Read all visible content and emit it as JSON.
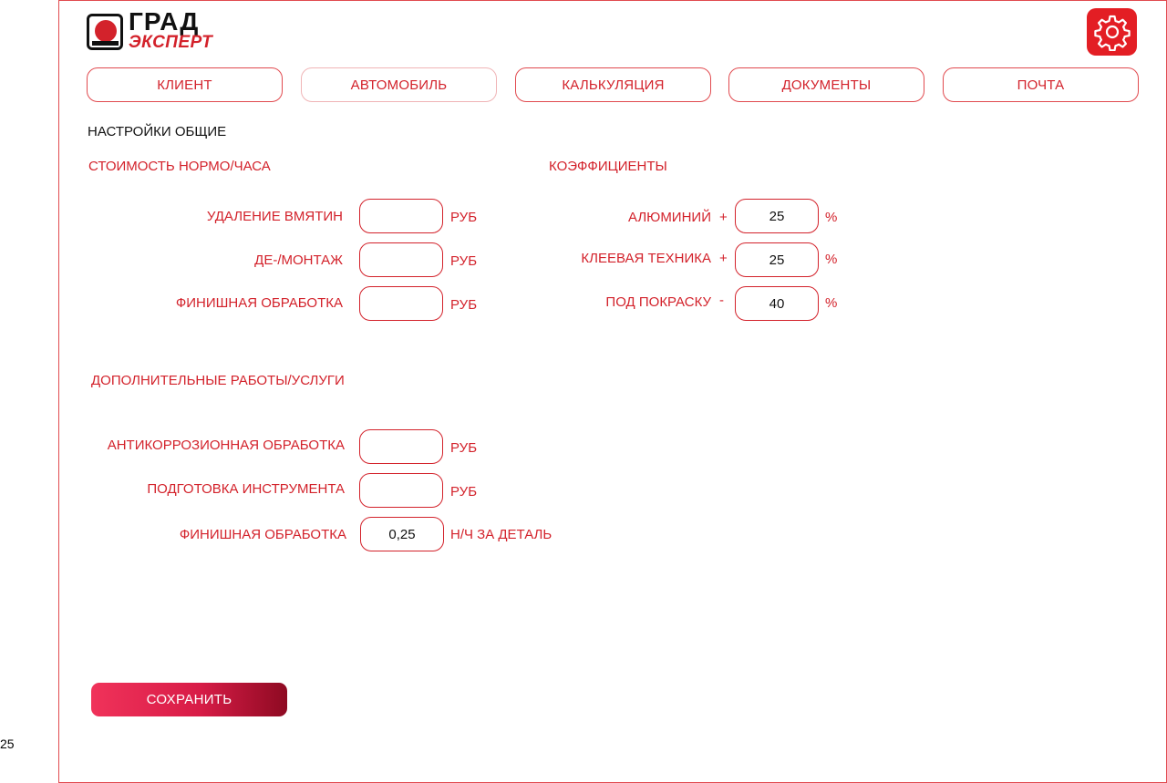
{
  "page_number": "25",
  "logo": {
    "line1": "ГРАД",
    "line2": "ЭКСПЕРТ"
  },
  "settings_icon": "gear-icon",
  "tabs": [
    {
      "label": "КЛИЕНТ",
      "active": false
    },
    {
      "label": "АВТОМОБИЛЬ",
      "active": true
    },
    {
      "label": "КАЛЬКУЛЯЦИЯ",
      "active": false
    },
    {
      "label": "ДОКУМЕНТЫ",
      "active": false
    },
    {
      "label": "ПОЧТА",
      "active": false
    }
  ],
  "page_title": "НАСТРОЙКИ ОБЩИЕ",
  "labor_cost": {
    "title": "СТОИМОСТЬ НОРМО/ЧАСА",
    "rows": [
      {
        "label": "УДАЛЕНИЕ ВМЯТИН",
        "value": "",
        "unit": "РУБ"
      },
      {
        "label": "ДЕ-/МОНТАЖ",
        "value": "",
        "unit": "РУБ"
      },
      {
        "label": "ФИНИШНАЯ ОБРАБОТКА",
        "value": "",
        "unit": "РУБ"
      }
    ]
  },
  "coefficients": {
    "title": "КОЭФФИЦИЕНТЫ",
    "rows": [
      {
        "label": "АЛЮМИНИЙ",
        "sign": "+",
        "value": "25",
        "unit": "%"
      },
      {
        "label": "КЛЕЕВАЯ ТЕХНИКА",
        "sign": "+",
        "value": "25",
        "unit": "%"
      },
      {
        "label": "ПОД ПОКРАСКУ",
        "sign": "-",
        "value": "40",
        "unit": "%"
      }
    ]
  },
  "extra_services": {
    "title": "ДОПОЛНИТЕЛЬНЫЕ РАБОТЫ/УСЛУГИ",
    "rows": [
      {
        "label": "АНТИКОРРОЗИОННАЯ ОБРАБОТКА",
        "value": "",
        "unit": "РУБ"
      },
      {
        "label": "ПОДГОТОВКА ИНСТРУМЕНТА",
        "value": "",
        "unit": "РУБ"
      },
      {
        "label": "ФИНИШНАЯ ОБРАБОТКА",
        "value": "0,25",
        "unit": "Н/Ч ЗА ДЕТАЛЬ"
      }
    ]
  },
  "save_label": "СОХРАНИТЬ",
  "colors": {
    "accent": "#d3222b",
    "border": "#e14a4f",
    "save_gradient_end": "#8e0a22"
  }
}
